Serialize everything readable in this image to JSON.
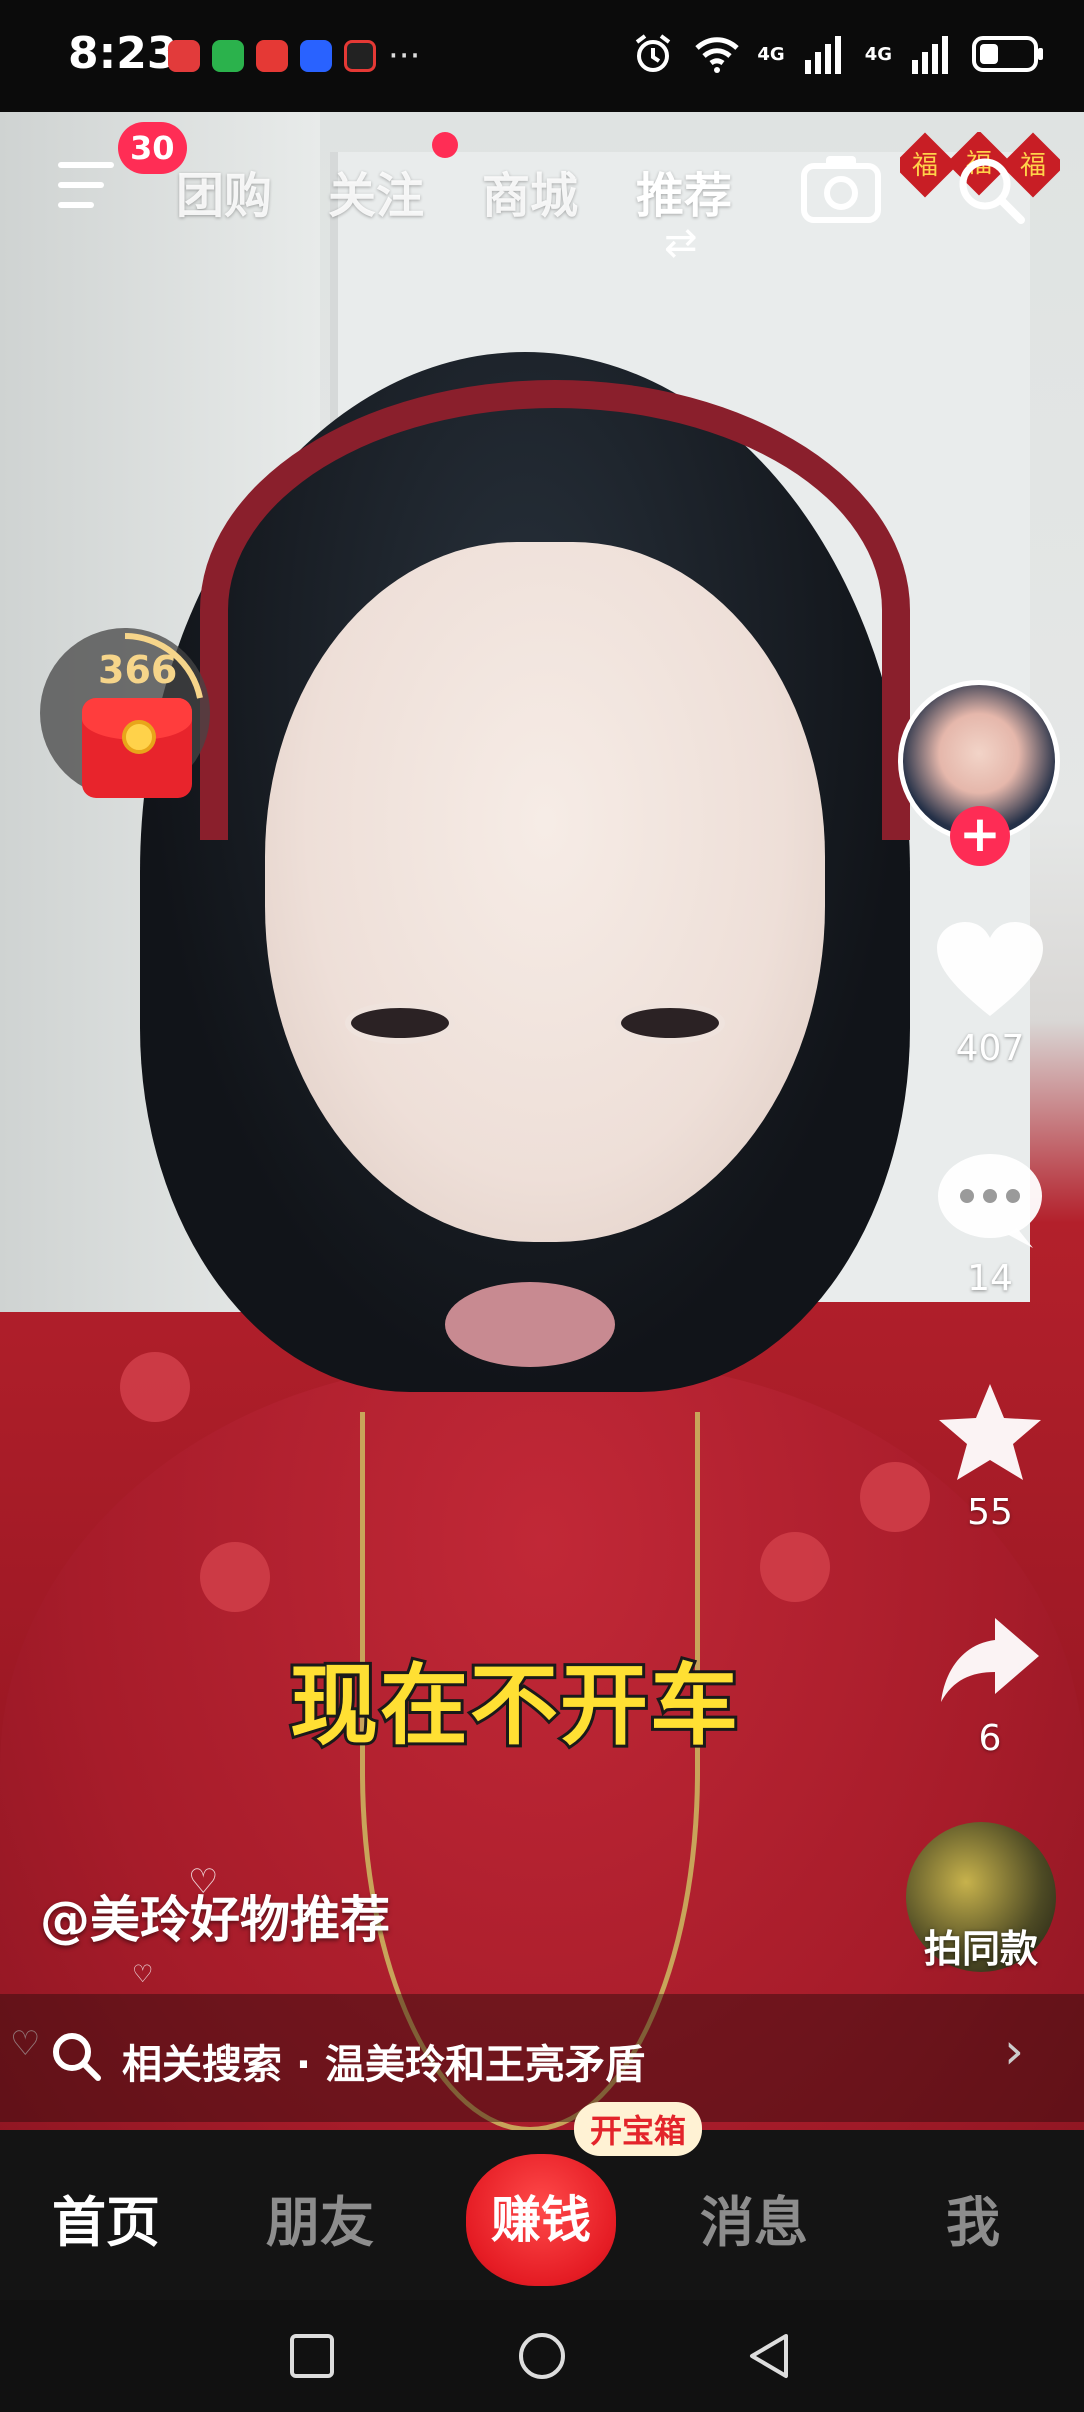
{
  "status_bar": {
    "time": "8:23",
    "more": "···",
    "network_1": "4G",
    "network_2": "4G"
  },
  "top_nav": {
    "menu_badge": "30",
    "tabs": [
      "团购",
      "关注",
      "商城",
      "推荐"
    ],
    "active_tab": "推荐",
    "fu_decoration": "福"
  },
  "red_packet": {
    "count": "366"
  },
  "video": {
    "caption": "现在不开车",
    "author": "@美玲好物推荐"
  },
  "right_rail": {
    "likes": "407",
    "comments": "14",
    "favorites": "55",
    "shares": "6",
    "same_style_label": "拍同款"
  },
  "related_search": {
    "text": "相关搜索 · 温美玲和王亮矛盾"
  },
  "bottom_nav": {
    "items": [
      "首页",
      "朋友",
      "赚钱",
      "消息",
      "我"
    ],
    "active": "首页",
    "earn_tag": "开宝箱"
  },
  "colors": {
    "accent_red": "#fe2c55",
    "caption_yellow": "#ffe033"
  }
}
